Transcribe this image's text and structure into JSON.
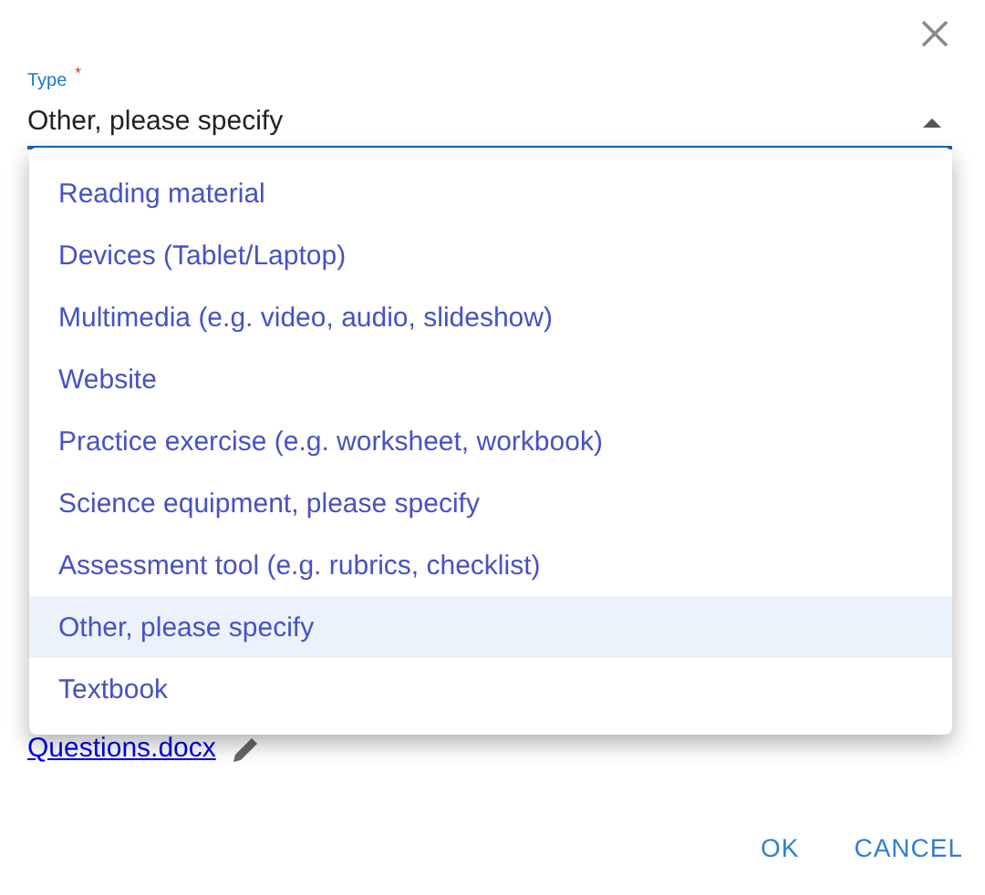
{
  "type_field": {
    "label": "Type",
    "required_mark": "*",
    "value": "Other, please specify",
    "expanded": true
  },
  "menu": [
    {
      "label": "Reading material",
      "selected": false
    },
    {
      "label": "Devices (Tablet/Laptop)",
      "selected": false
    },
    {
      "label": "Multimedia (e.g. video, audio, slideshow)",
      "selected": false
    },
    {
      "label": "Website",
      "selected": false
    },
    {
      "label": "Practice exercise (e.g. worksheet, workbook)",
      "selected": false
    },
    {
      "label": "Science equipment, please specify",
      "selected": false
    },
    {
      "label": "Assessment tool (e.g. rubrics, checklist)",
      "selected": false
    },
    {
      "label": "Other, please specify",
      "selected": true
    },
    {
      "label": "Textbook",
      "selected": false
    }
  ],
  "attachment": {
    "name": "Questions.docx"
  },
  "buttons": [
    "OK",
    "CANCEL"
  ]
}
